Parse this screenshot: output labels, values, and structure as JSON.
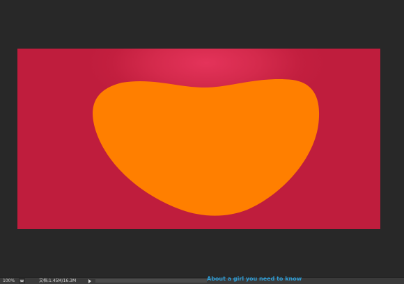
{
  "app": {
    "workspace_color": "#282828",
    "canvas_color": "#c31f3f",
    "canvas_highlight_color": "#e4335a",
    "shape_color": "#ff7f00"
  },
  "statusbar": {
    "zoom": "100%",
    "document_info": "文档:1.45M/16.3M",
    "menu_icon": "triangle-right-icon"
  },
  "watermark": {
    "text": "About a girl you need to know"
  }
}
